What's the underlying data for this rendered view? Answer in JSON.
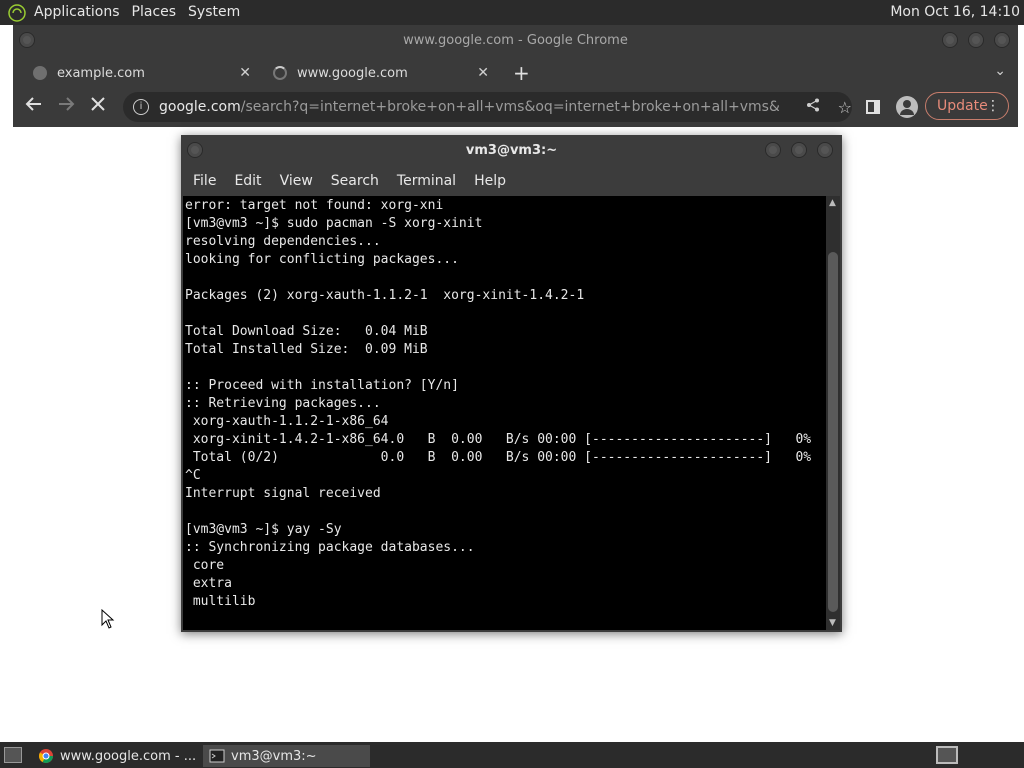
{
  "top_panel": {
    "menus": [
      "Applications",
      "Places",
      "System"
    ],
    "clock": "Mon Oct 16, 14:10"
  },
  "chrome": {
    "window_title": "www.google.com - Google Chrome",
    "tabs": [
      {
        "title": "example.com",
        "close": "✕"
      },
      {
        "title": "www.google.com",
        "close": "✕"
      }
    ],
    "new_tab": "+",
    "url_host": "google.com",
    "url_rest": "/search?q=internet+broke+on+all+vms&oq=internet+broke+on+all+vms&aqs=chrome.....",
    "update_label": "Update",
    "info_icon": "i"
  },
  "terminal": {
    "title": "vm3@vm3:~",
    "menus": [
      "File",
      "Edit",
      "View",
      "Search",
      "Terminal",
      "Help"
    ],
    "output": "error: target not found: xorg-xni\n[vm3@vm3 ~]$ sudo pacman -S xorg-xinit\nresolving dependencies...\nlooking for conflicting packages...\n\nPackages (2) xorg-xauth-1.1.2-1  xorg-xinit-1.4.2-1\n\nTotal Download Size:   0.04 MiB\nTotal Installed Size:  0.09 MiB\n\n:: Proceed with installation? [Y/n]\n:: Retrieving packages...\n xorg-xauth-1.1.2-1-x86_64\n xorg-xinit-1.4.2-1-x86_64.0   B  0.00   B/s 00:00 [----------------------]   0%\n Total (0/2)             0.0   B  0.00   B/s 00:00 [----------------------]   0%\n^C\nInterrupt signal received\n\n[vm3@vm3 ~]$ yay -Sy\n:: Synchronizing package databases...\n core\n extra\n multilib"
  },
  "taskbar": {
    "tasks": [
      {
        "label": "www.google.com - ..."
      },
      {
        "label": "vm3@vm3:~"
      }
    ]
  }
}
